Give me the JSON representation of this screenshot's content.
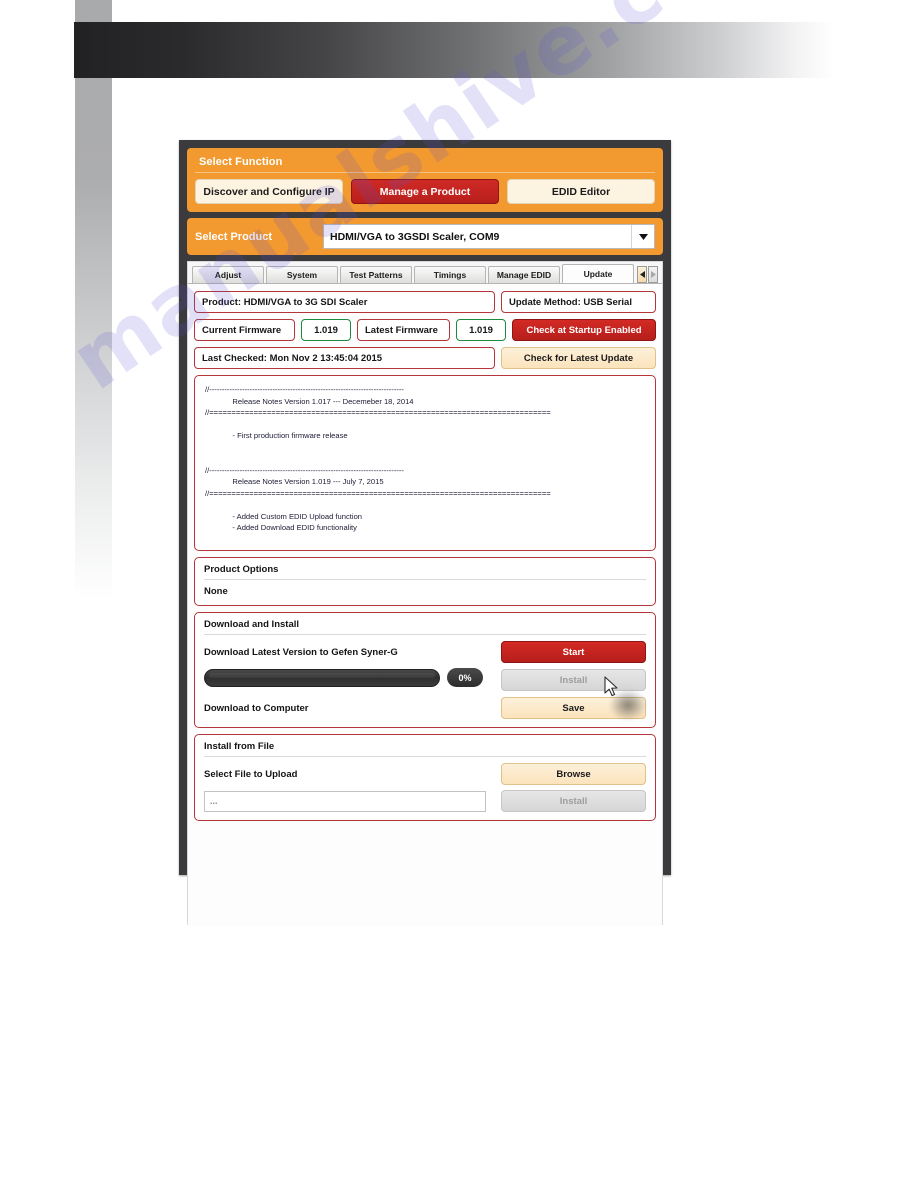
{
  "watermark": "manualshive.com",
  "select_function": {
    "title": "Select Function",
    "buttons": [
      {
        "label": "Discover and Configure IP",
        "state": "normal"
      },
      {
        "label": "Manage a Product",
        "state": "active"
      },
      {
        "label": "EDID Editor",
        "state": "normal"
      }
    ]
  },
  "select_product": {
    "label": "Select Product",
    "value": "HDMI/VGA to 3GSDI Scaler, COM9",
    "arrow_icon": "chevron-down-icon"
  },
  "tabs": {
    "items": [
      {
        "label": "Adjust",
        "active": false
      },
      {
        "label": "System",
        "active": false
      },
      {
        "label": "Test Patterns",
        "active": false
      },
      {
        "label": "Timings",
        "active": false
      },
      {
        "label": "Manage EDID",
        "active": false
      },
      {
        "label": "Update",
        "active": true
      }
    ],
    "scroll_left_icon": "triangle-left-icon",
    "scroll_right_icon": "triangle-right-icon"
  },
  "update": {
    "product_field": "Product: HDMI/VGA to 3G SDI Scaler",
    "update_method_field": "Update Method: USB Serial",
    "current_firmware_label": "Current Firmware",
    "current_firmware_value": "1.019",
    "latest_firmware_label": "Latest Firmware",
    "latest_firmware_value": "1.019",
    "check_startup_button": "Check at Startup Enabled",
    "last_checked_field": "Last Checked: Mon Nov 2 13:45:04 2015",
    "check_update_button": "Check for Latest Update",
    "release_notes": "//-----------------------------------------------------------------------------\n             Release Notes Version 1.017 --- Decemeber 18, 2014\n//=============================================================================\n\n             - First production firmware release\n\n\n//-----------------------------------------------------------------------------\n             Release Notes Version 1.019 --- July 7, 2015\n//=============================================================================\n\n             - Added Custom EDID Upload function\n             - Added Download EDID functionality"
  },
  "product_options": {
    "title": "Product Options",
    "value": "None"
  },
  "download_install": {
    "title": "Download and Install",
    "download_latest_label": "Download Latest Version to Gefen Syner-G",
    "start_button": "Start",
    "progress_percent": "0%",
    "progress_value": 0,
    "install_button": "Install",
    "download_computer_label": "Download to Computer",
    "save_button": "Save"
  },
  "install_from_file": {
    "title": "Install from File",
    "select_file_label": "Select File to Upload",
    "browse_button": "Browse",
    "file_path_value": "...",
    "install_button": "Install"
  },
  "colors": {
    "orange": "#f2992f",
    "red": "#c1272d",
    "cream": "#fdf3e1",
    "green": "#1d8a3f",
    "frame": "#3b3b3d"
  }
}
